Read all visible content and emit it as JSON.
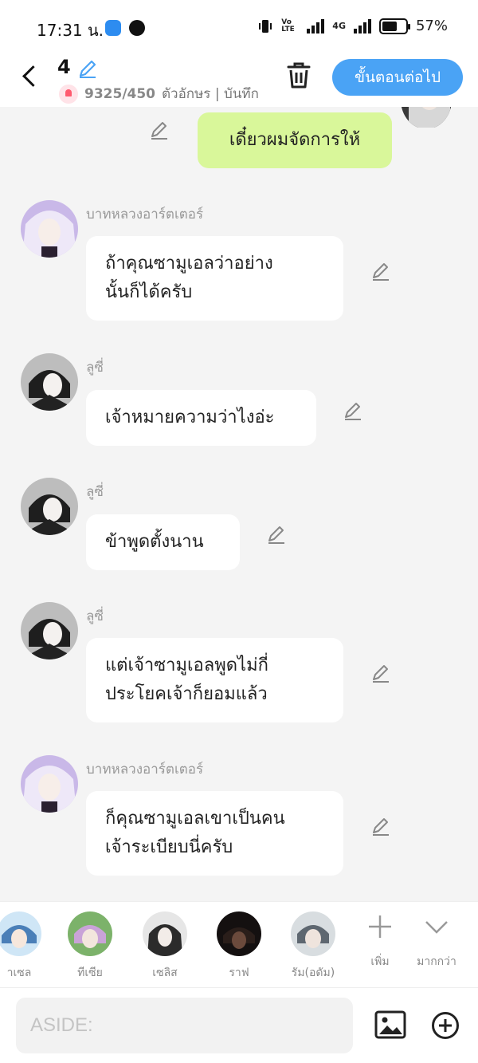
{
  "status_bar": {
    "time": "17:31 น.",
    "signal_labels": [
      "Vo LTE",
      "4G"
    ],
    "battery": "57%"
  },
  "header": {
    "episode": "4",
    "char_count": "9325/450",
    "meta_text": "ตัวอักษร | บันทึก",
    "next_button": "ขั้นตอนต่อไป"
  },
  "messages": [
    {
      "side": "right",
      "text": "เดี๋ยวผมจัดการให้"
    },
    {
      "side": "left",
      "speaker": "บาทหลวงอาร์ตเตอร์",
      "lines": [
        "ถ้าคุณซามูเอลว่าอย่าง",
        "นั้นก็ได้ครับ"
      ]
    },
    {
      "side": "left",
      "speaker": "ลูซี่",
      "lines": [
        "เจ้าหมายความว่าไงอ่ะ"
      ]
    },
    {
      "side": "left",
      "speaker": "ลูซี่",
      "lines": [
        "ข้าพูดตั้งนาน"
      ]
    },
    {
      "side": "left",
      "speaker": "ลูซี่",
      "lines": [
        "แต่เจ้าซามูเอลพูดไม่กี่",
        "ประโยคเจ้าก็ยอมแล้ว"
      ]
    },
    {
      "side": "left",
      "speaker": "บาทหลวงอาร์ตเตอร์",
      "lines": [
        "ก็คุณซามูเอลเขาเป็นคน",
        "เจ้าระเบียบนี่ครับ"
      ]
    }
  ],
  "characters": [
    {
      "label": "าเซล"
    },
    {
      "label": "ทีเซีย"
    },
    {
      "label": "เซลิส"
    },
    {
      "label": "ราฟ"
    },
    {
      "label": "รัม(อดัม)"
    }
  ],
  "tools": {
    "add_label": "เพิ่ม",
    "more_label": "มากกว่า"
  },
  "input": {
    "placeholder": "ASIDE:"
  },
  "colors": {
    "accent": "#4aa3f5",
    "my_bubble": "#d9f79a",
    "background": "#f4f4f4"
  }
}
